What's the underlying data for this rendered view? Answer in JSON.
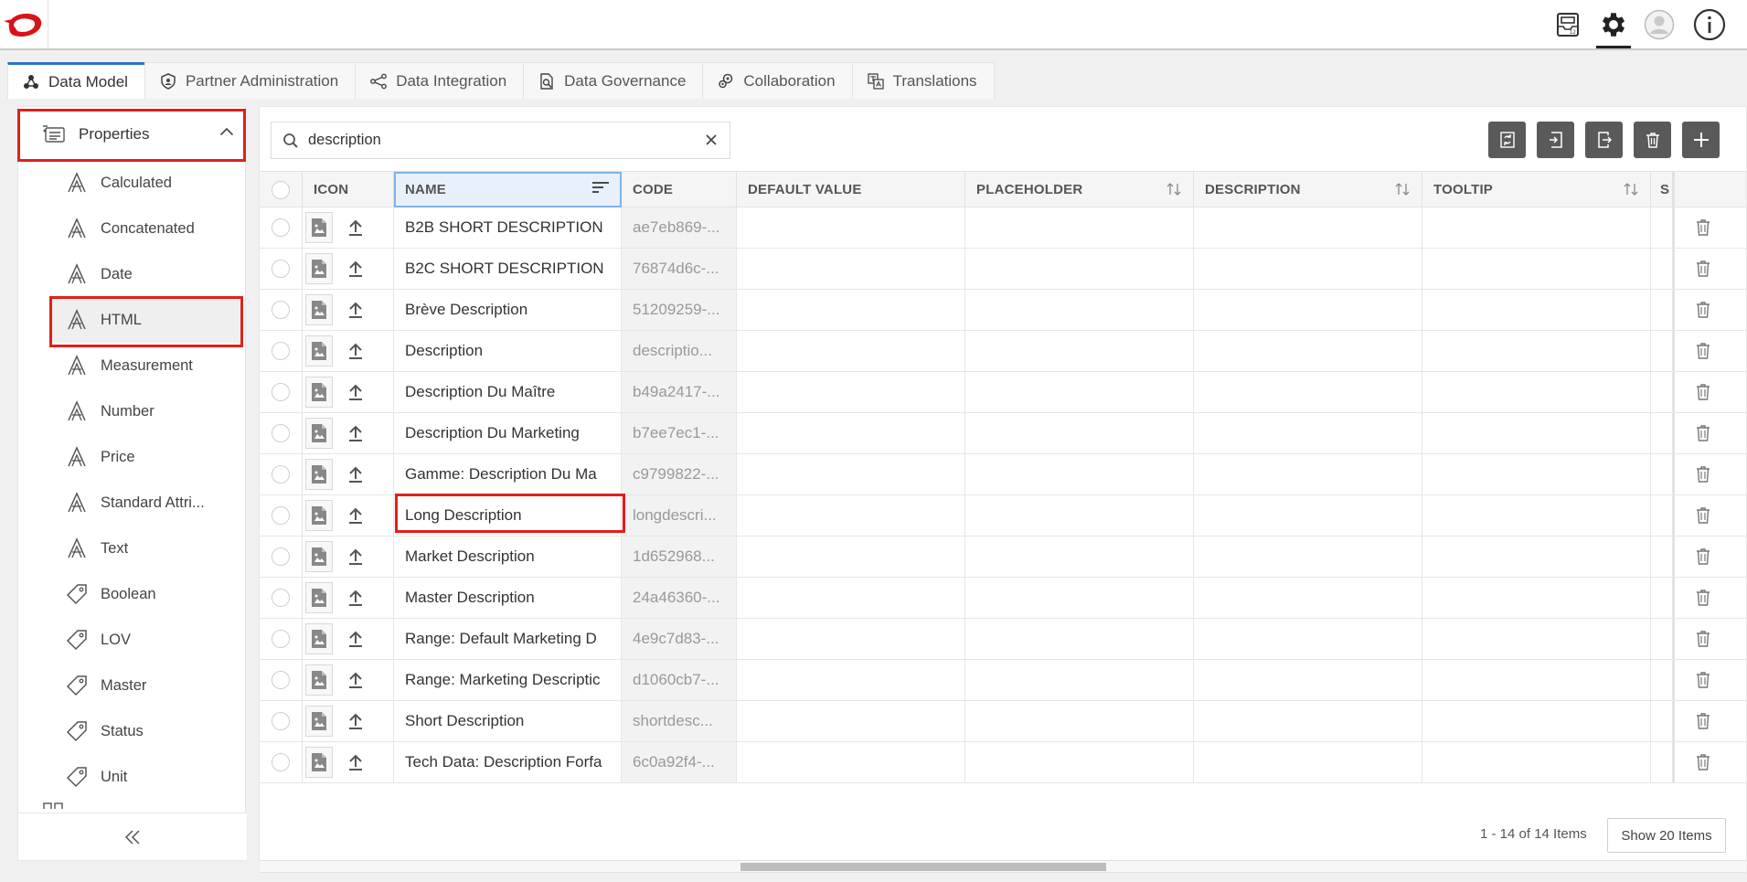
{
  "topbar": {
    "icons": [
      "logo",
      "inbox-icon",
      "gear-icon",
      "user-avatar-icon",
      "info-icon"
    ]
  },
  "tabs": [
    {
      "label": "Data Model",
      "icon": "data-model-icon",
      "active": true
    },
    {
      "label": "Partner Administration",
      "icon": "shield-icon",
      "active": false
    },
    {
      "label": "Data Integration",
      "icon": "integration-icon",
      "active": false
    },
    {
      "label": "Data Governance",
      "icon": "governance-icon",
      "active": false
    },
    {
      "label": "Collaboration",
      "icon": "collaboration-icon",
      "active": false
    },
    {
      "label": "Translations",
      "icon": "translations-icon",
      "active": false
    }
  ],
  "sidebar": {
    "header": "Properties",
    "items": [
      {
        "label": "Calculated",
        "icon": "attribute-icon"
      },
      {
        "label": "Concatenated",
        "icon": "attribute-icon"
      },
      {
        "label": "Date",
        "icon": "attribute-icon"
      },
      {
        "label": "HTML",
        "icon": "attribute-icon",
        "active": true
      },
      {
        "label": "Measurement",
        "icon": "attribute-icon"
      },
      {
        "label": "Number",
        "icon": "attribute-icon"
      },
      {
        "label": "Price",
        "icon": "attribute-icon"
      },
      {
        "label": "Standard Attri...",
        "icon": "attribute-icon"
      },
      {
        "label": "Text",
        "icon": "attribute-icon"
      },
      {
        "label": "Boolean",
        "icon": "tag-icon"
      },
      {
        "label": "LOV",
        "icon": "tag-icon"
      },
      {
        "label": "Master",
        "icon": "tag-icon"
      },
      {
        "label": "Status",
        "icon": "tag-icon"
      },
      {
        "label": "Unit",
        "icon": "tag-icon"
      }
    ]
  },
  "search": {
    "value": "description"
  },
  "grid": {
    "columns": [
      "ICON",
      "NAME",
      "CODE",
      "DEFAULT VALUE",
      "PLACEHOLDER",
      "DESCRIPTION",
      "TOOLTIP",
      "S"
    ],
    "rows": [
      {
        "name": "B2B SHORT DESCRIPTION",
        "code": "ae7eb869-..."
      },
      {
        "name": "B2C SHORT DESCRIPTION",
        "code": "76874d6c-..."
      },
      {
        "name": " Brève Description",
        "code": "51209259-..."
      },
      {
        "name": "Description",
        "code": "descriptio..."
      },
      {
        "name": "Description Du Maître",
        "code": "b49a2417-..."
      },
      {
        "name": "Description Du Marketing",
        "code": "b7ee7ec1-..."
      },
      {
        "name": "Gamme: Description Du Ma",
        "code": "c9799822-..."
      },
      {
        "name": "Long Description",
        "code": "longdescri..."
      },
      {
        "name": "Market Description",
        "code": "1d652968..."
      },
      {
        "name": "Master Description",
        "code": "24a46360-..."
      },
      {
        "name": "Range: Default Marketing D",
        "code": "4e9c7d83-..."
      },
      {
        "name": "Range: Marketing Descriptic",
        "code": "d1060cb7-..."
      },
      {
        "name": "Short Description",
        "code": "shortdesc..."
      },
      {
        "name": "Tech Data: Description Forfa",
        "code": "6c0a92f4-..."
      }
    ]
  },
  "pager": {
    "info": "1 - 14 of 14 Items",
    "button": "Show 20 Items"
  },
  "colors": {
    "accent": "#2a72c9",
    "highlight": "#e0201b",
    "action_button": "#5a5a5a",
    "logo_red": "#d7141a"
  }
}
